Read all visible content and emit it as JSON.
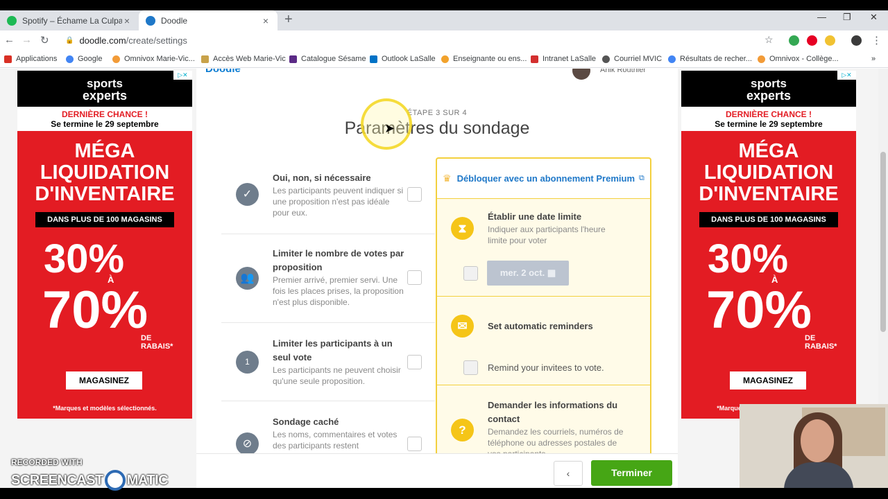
{
  "browser": {
    "tabs": [
      {
        "title": "Spotify – Échame La Culpa",
        "active": false,
        "favicon_color": "#1db954"
      },
      {
        "title": "Doodle",
        "active": true,
        "favicon_color": "#1f78c8"
      }
    ],
    "url_host": "doodle.com",
    "url_path": "/create/settings",
    "bookmarks": [
      {
        "label": "Applications",
        "icon": "apps-grid-icon",
        "color": "#d93025"
      },
      {
        "label": "Google",
        "icon": "google-icon",
        "color": "#4285f4"
      },
      {
        "label": "Omnivox Marie-Vic...",
        "icon": "omnivox-icon",
        "color": "#f29b38"
      },
      {
        "label": "Accès Web Marie-Vic",
        "icon": "folder-icon",
        "color": "#c8a24a"
      },
      {
        "label": "Catalogue Sésame",
        "icon": "sesame-icon",
        "color": "#5b2a86"
      },
      {
        "label": "Outlook LaSalle",
        "icon": "outlook-icon",
        "color": "#0072c6"
      },
      {
        "label": "Enseignante ou ens...",
        "icon": "teacher-icon",
        "color": "#f2a22c"
      },
      {
        "label": "Intranet LaSalle",
        "icon": "intranet-icon",
        "color": "#d32f2f"
      },
      {
        "label": "Courriel MVIC",
        "icon": "globe-icon",
        "color": "#555555"
      },
      {
        "label": "Résultats de recher...",
        "icon": "google-icon",
        "color": "#4285f4"
      },
      {
        "label": "Omnivox - Collège...",
        "icon": "omnivox-icon",
        "color": "#f29b38"
      }
    ]
  },
  "ad": {
    "brand_line1": "sports",
    "brand_line2": "experts",
    "last_chance": "DERNIÈRE CHANCE !",
    "ends": "Se termine le 29 septembre",
    "mega": [
      "MÉGA",
      "LIQUIDATION",
      "D'INVENTAIRE"
    ],
    "stores": "DANS PLUS DE 100 MAGASINS",
    "pct_low": "30%",
    "a": "À",
    "pct_high": "70%",
    "de": "DE",
    "rabais": "RABAIS*",
    "cta": "MAGASINEZ",
    "fine": "*Marques et modèles sélectionnés."
  },
  "doodle": {
    "logo": "Doodle",
    "user_name": "Anik Routhier",
    "step": "ÉTAPE 3 SUR 4",
    "title": "Paramètres du sondage",
    "options": [
      {
        "title": "Oui, non, si nécessaire",
        "desc": "Les participants peuvent indiquer si une proposition n'est pas idéale pour eux.",
        "icon": "check-circle-icon"
      },
      {
        "title": "Limiter le nombre de votes par proposition",
        "desc": "Premier arrivé, premier servi. Une fois les places prises, la proposition n'est plus disponible.",
        "icon": "group-icon"
      },
      {
        "title": "Limiter les participants à un seul vote",
        "desc": "Les participants ne peuvent choisir qu'une seule proposition.",
        "icon": "number-one-icon"
      },
      {
        "title": "Sondage caché",
        "desc": "Les noms, commentaires et votes des participants restent confidentiels. Seul vous",
        "icon": "eye-off-icon"
      }
    ],
    "premium": {
      "link": "Débloquer avec un abonnement Premium",
      "deadline_title": "Établir une date limite",
      "deadline_desc": "Indiquer aux participants l'heure limite pour voter",
      "date": "mer. 2 oct.",
      "reminders_title": "Set automatic reminders",
      "reminders_check": "Remind your invitees to vote.",
      "contact_title": "Demander les informations du contact",
      "contact_desc": "Demandez les courriels, numéros de téléphone ou adresses postales de vos participants"
    },
    "back": "‹",
    "finish": "Terminer"
  },
  "watermark": {
    "line1": "RECORDED WITH",
    "line2a": "SCREENCAST",
    "line2b": "MATIC"
  },
  "colors": {
    "accent_green": "#46a615",
    "premium_yellow": "#f3d03e",
    "link_blue": "#1f78c8",
    "ad_red": "#e31c23"
  }
}
